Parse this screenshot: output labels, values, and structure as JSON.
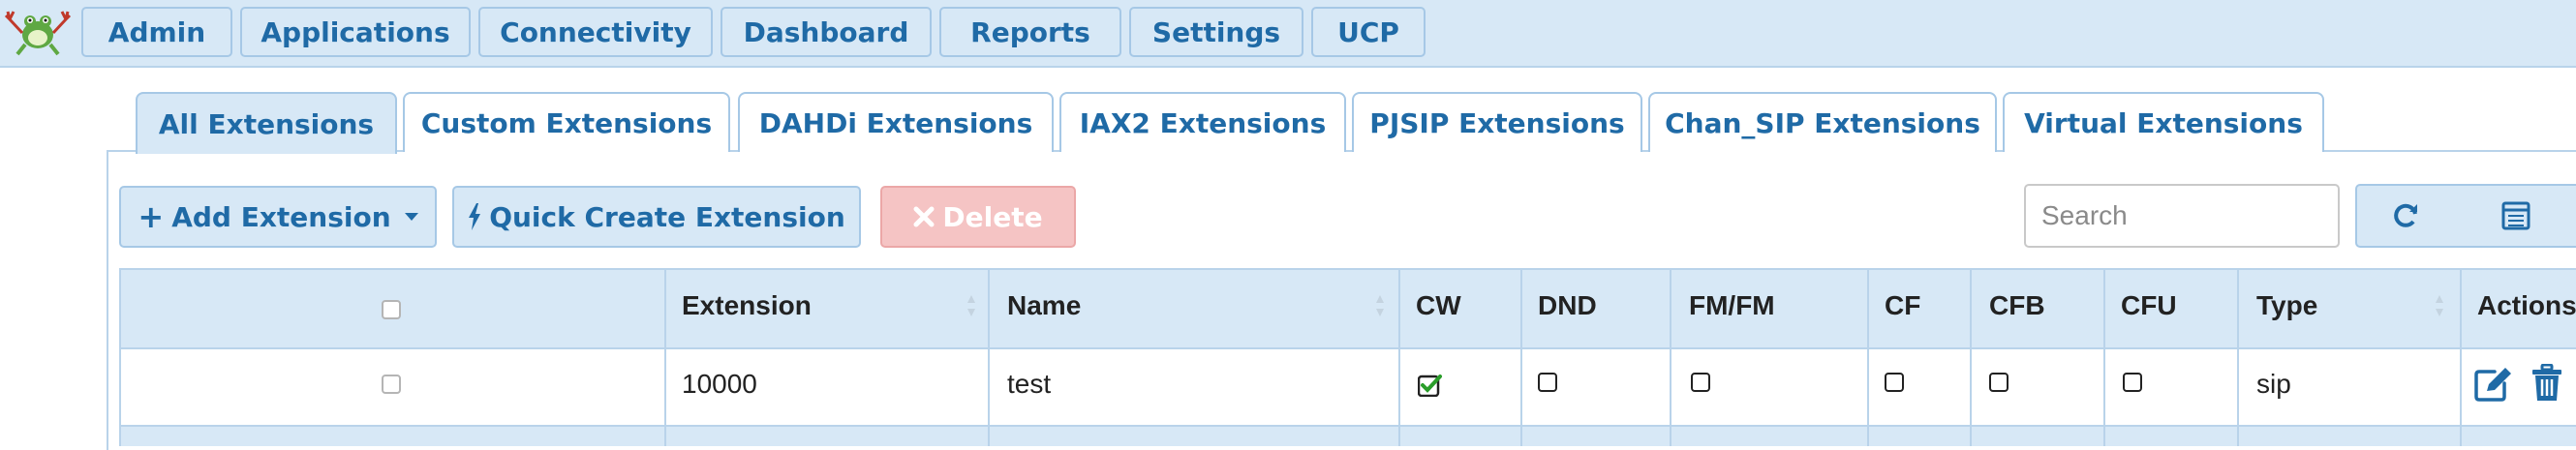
{
  "nav": {
    "items": [
      "Admin",
      "Applications",
      "Connectivity",
      "Dashboard",
      "Reports",
      "Settings",
      "UCP"
    ]
  },
  "tabs": [
    "All Extensions",
    "Custom Extensions",
    "DAHDi Extensions",
    "IAX2 Extensions",
    "PJSIP Extensions",
    "Chan_SIP Extensions",
    "Virtual Extensions"
  ],
  "active_tab": "All Extensions",
  "toolbar": {
    "add_label": "Add Extension",
    "quick_create_label": "Quick Create Extension",
    "delete_label": "Delete",
    "search_placeholder": "Search",
    "icons": [
      "plus-icon",
      "bolt-icon",
      "times-icon",
      "refresh-icon",
      "list-icon"
    ]
  },
  "table": {
    "columns": [
      "",
      "Extension",
      "Name",
      "CW",
      "DND",
      "FM/FM",
      "CF",
      "CFB",
      "CFU",
      "Type",
      "Actions"
    ],
    "rows": [
      {
        "selected": false,
        "extension": "10000",
        "name": "test",
        "cw": true,
        "dnd": false,
        "fmfm": false,
        "cf": false,
        "cfb": false,
        "cfu": false,
        "type": "sip",
        "actions": [
          "edit-icon",
          "trash-icon"
        ]
      }
    ]
  },
  "colors": {
    "accent": "#1f6aa6",
    "nav_bg": "#d7e8f6",
    "border": "#a6c8e6",
    "danger_bg": "#f5c4c4",
    "check_green": "#2a9d2a"
  }
}
